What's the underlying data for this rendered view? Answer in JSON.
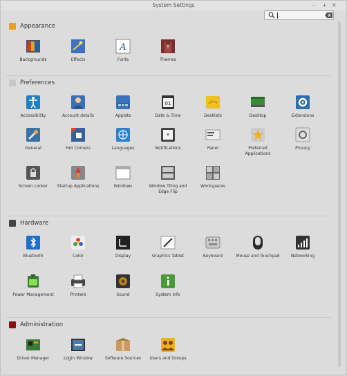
{
  "window": {
    "title": "System Settings",
    "minimize": "–",
    "maximize": "+",
    "close": "×"
  },
  "search": {
    "value": "",
    "placeholder": ""
  },
  "sections": [
    {
      "title": "Appearance",
      "icon": "appearance-category-icon",
      "color": "#e8a020",
      "items": [
        {
          "label": "Backgrounds",
          "icon": "backgrounds-icon"
        },
        {
          "label": "Effects",
          "icon": "effects-icon"
        },
        {
          "label": "Fonts",
          "icon": "fonts-icon"
        },
        {
          "label": "Themes",
          "icon": "themes-icon"
        }
      ]
    },
    {
      "title": "Preferences",
      "icon": "preferences-category-icon",
      "color": "#c8c8c8",
      "items": [
        {
          "label": "Accessibility",
          "icon": "accessibility-icon"
        },
        {
          "label": "Account details",
          "icon": "account-details-icon"
        },
        {
          "label": "Applets",
          "icon": "applets-icon"
        },
        {
          "label": "Date & Time",
          "icon": "date-time-icon"
        },
        {
          "label": "Desklets",
          "icon": "desklets-icon"
        },
        {
          "label": "Desktop",
          "icon": "desktop-icon"
        },
        {
          "label": "Extensions",
          "icon": "extensions-icon"
        },
        {
          "label": "General",
          "icon": "general-icon"
        },
        {
          "label": "Hot Corners",
          "icon": "hot-corners-icon"
        },
        {
          "label": "Languages",
          "icon": "languages-icon"
        },
        {
          "label": "Notifications",
          "icon": "notifications-icon"
        },
        {
          "label": "Panel",
          "icon": "panel-icon"
        },
        {
          "label": "Preferred Applications",
          "icon": "preferred-applications-icon"
        },
        {
          "label": "Privacy",
          "icon": "privacy-icon"
        },
        {
          "label": "Screen Locker",
          "icon": "screen-locker-icon"
        },
        {
          "label": "Startup Applications",
          "icon": "startup-applications-icon"
        },
        {
          "label": "Windows",
          "icon": "windows-icon"
        },
        {
          "label": "Window Tiling and Edge Flip",
          "icon": "window-tiling-icon"
        },
        {
          "label": "Workspaces",
          "icon": "workspaces-icon"
        }
      ]
    },
    {
      "title": "Hardware",
      "icon": "hardware-category-icon",
      "color": "#444444",
      "items": [
        {
          "label": "Bluetooth",
          "icon": "bluetooth-icon"
        },
        {
          "label": "Color",
          "icon": "color-icon"
        },
        {
          "label": "Display",
          "icon": "display-icon"
        },
        {
          "label": "Graphics Tablet",
          "icon": "graphics-tablet-icon"
        },
        {
          "label": "Keyboard",
          "icon": "keyboard-icon"
        },
        {
          "label": "Mouse and Touchpad",
          "icon": "mouse-icon"
        },
        {
          "label": "Networking",
          "icon": "networking-icon"
        },
        {
          "label": "Power Management",
          "icon": "power-management-icon"
        },
        {
          "label": "Printers",
          "icon": "printers-icon"
        },
        {
          "label": "Sound",
          "icon": "sound-icon"
        },
        {
          "label": "System Info",
          "icon": "system-info-icon"
        }
      ]
    },
    {
      "title": "Administration",
      "icon": "administration-category-icon",
      "color": "#8a1010",
      "items": [
        {
          "label": "Driver Manager",
          "icon": "driver-manager-icon"
        },
        {
          "label": "Login Window",
          "icon": "login-window-icon"
        },
        {
          "label": "Software Sources",
          "icon": "software-sources-icon"
        },
        {
          "label": "Users and Groups",
          "icon": "users-groups-icon"
        }
      ]
    }
  ]
}
